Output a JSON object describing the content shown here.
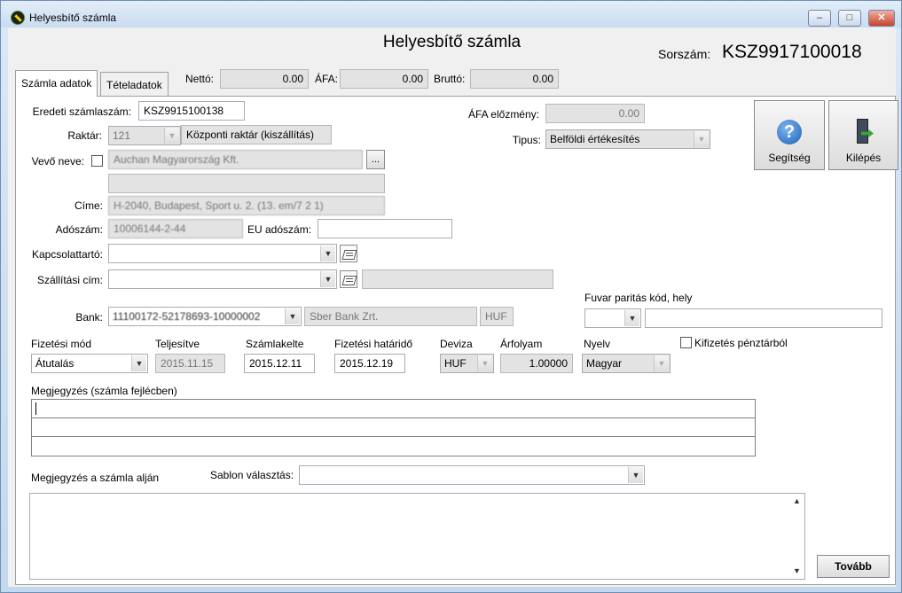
{
  "window": {
    "title": "Helyesbítő számla",
    "controls": {
      "minimize": "–",
      "maximize": "□",
      "close": "✕"
    }
  },
  "header": {
    "form_title": "Helyesbítő számla",
    "sorszam_label": "Sorszám:",
    "sorszam_value": "KSZ9917100018"
  },
  "tabs": [
    {
      "label": "Számla adatok",
      "active": true
    },
    {
      "label": "Tételadatok",
      "active": false
    }
  ],
  "totals": {
    "netto_label": "Nettó:",
    "netto_value": "0.00",
    "afa_label": "ÁFA:",
    "afa_value": "0.00",
    "brutto_label": "Bruttó:",
    "brutto_value": "0.00"
  },
  "form": {
    "eredeti_label": "Eredeti számlaszám:",
    "eredeti_value": "KSZ9915100138",
    "raktar_label": "Raktár:",
    "raktar_value": "121",
    "raktar_name": "Központi raktár  (kiszállítás)",
    "vevo_label": "Vevő neve:",
    "vevo_value": "Auchan Magyarország Kft.",
    "vevo_btn": "...",
    "vevo_line2": "",
    "cime_label": "Címe:",
    "cime_value": "H-2040, Budapest, Sport u. 2. (13. em/7 2 1)",
    "adoszam_label": "Adószám:",
    "adoszam_value": "10006144-2-44",
    "eu_adoszam_label": "EU adószám:",
    "eu_adoszam_value": "",
    "kapcsolattarto_label": "Kapcsolattartó:",
    "kapcsolattarto_value": "",
    "szallitasi_label": "Szállítási cím:",
    "szallitasi_value": "",
    "szallitasi_extra": "",
    "bank_label": "Bank:",
    "bank_account": "11100172-52178693-10000002",
    "bank_name": "Sber Bank Zrt.",
    "bank_currency": "HUF",
    "afa_elozmeny_label": "ÁFA előzmény:",
    "afa_elozmeny_value": "0.00",
    "tipus_label": "Tipus:",
    "tipus_value": "Belföldi értékesítés",
    "fuvar_label": "Fuvar paritás kód, hely",
    "fuvar_code": "",
    "fuvar_place": "",
    "fizmod_label": "Fizetési mód",
    "fizmod_value": "Átutalás",
    "teljesitve_label": "Teljesítve",
    "teljesitve_value": "2015.11.15",
    "szamlakelte_label": "Számlakelte",
    "szamlakelte_value": "2015.12.11",
    "hatarido_label": "Fizetési határidő",
    "hatarido_value": "2015.12.19",
    "deviza_label": "Deviza",
    "deviza_value": "HUF",
    "arfolyam_label": "Árfolyam",
    "arfolyam_value": "1.00000",
    "nyelv_label": "Nyelv",
    "nyelv_value": "Magyar",
    "kifizetes_label": "Kifizetés pénztárból",
    "megjegyzes_fejlec_label": "Megjegyzés (számla fejlécben)",
    "megjegyzes_aljan_label": "Megjegyzés a számla alján",
    "sablon_label": "Sablon választás:",
    "sablon_value": ""
  },
  "buttons": {
    "help_label": "Segítség",
    "exit_label": "Kilépés",
    "next_label": "Tovább"
  },
  "icons": {
    "app": "app-icon",
    "help": "help-icon",
    "exit": "exit-door-icon",
    "note": "notepad-icon"
  }
}
